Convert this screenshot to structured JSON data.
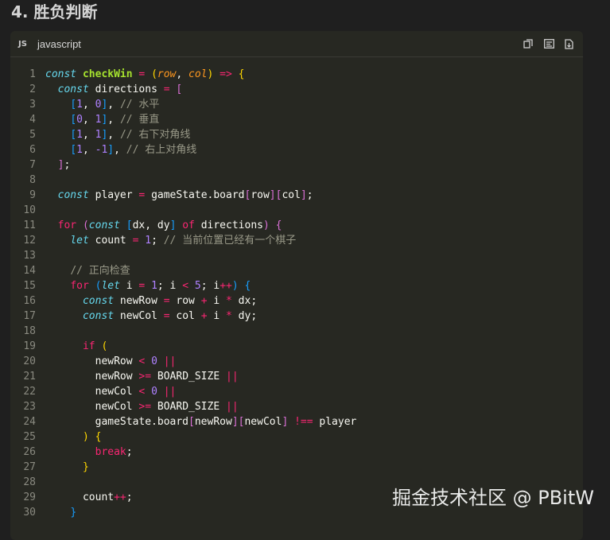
{
  "heading": "4. 胜负判断",
  "panel": {
    "badge": "JS",
    "language": "javascript",
    "actions": [
      "copy-icon",
      "wrap-icon",
      "download-icon"
    ]
  },
  "watermark": "掘金技术社区 @ PBitW",
  "colors": {
    "background": "#272822",
    "keyword": "#66d9ef",
    "control": "#f92672",
    "function": "#a6e22e",
    "param": "#fd971f",
    "number": "#ae81ff",
    "comment": "#999988"
  },
  "code": [
    {
      "n": "1",
      "t": [
        [
          "const",
          "kw"
        ],
        [
          " ",
          "id"
        ],
        [
          "checkWin",
          "fn"
        ],
        [
          " = ",
          "op"
        ],
        [
          "(",
          "br1"
        ],
        [
          "row",
          "param"
        ],
        [
          ", ",
          "punc"
        ],
        [
          "col",
          "param"
        ],
        [
          ")",
          "br1"
        ],
        [
          " => ",
          "op"
        ],
        [
          "{",
          "br1"
        ]
      ]
    },
    {
      "n": "2",
      "t": [
        [
          "  ",
          "id"
        ],
        [
          "const",
          "kw"
        ],
        [
          " directions",
          "id"
        ],
        [
          " = ",
          "op"
        ],
        [
          "[",
          "br2"
        ]
      ]
    },
    {
      "n": "3",
      "t": [
        [
          "    ",
          "id"
        ],
        [
          "[",
          "br3"
        ],
        [
          "1",
          "num"
        ],
        [
          ", ",
          "punc"
        ],
        [
          "0",
          "num"
        ],
        [
          "]",
          "br3"
        ],
        [
          ", ",
          "punc"
        ],
        [
          "// 水平",
          "cmt"
        ]
      ]
    },
    {
      "n": "4",
      "t": [
        [
          "    ",
          "id"
        ],
        [
          "[",
          "br3"
        ],
        [
          "0",
          "num"
        ],
        [
          ", ",
          "punc"
        ],
        [
          "1",
          "num"
        ],
        [
          "]",
          "br3"
        ],
        [
          ", ",
          "punc"
        ],
        [
          "// 垂直",
          "cmt"
        ]
      ]
    },
    {
      "n": "5",
      "t": [
        [
          "    ",
          "id"
        ],
        [
          "[",
          "br3"
        ],
        [
          "1",
          "num"
        ],
        [
          ", ",
          "punc"
        ],
        [
          "1",
          "num"
        ],
        [
          "]",
          "br3"
        ],
        [
          ", ",
          "punc"
        ],
        [
          "// 右下对角线",
          "cmt"
        ]
      ]
    },
    {
      "n": "6",
      "t": [
        [
          "    ",
          "id"
        ],
        [
          "[",
          "br3"
        ],
        [
          "1",
          "num"
        ],
        [
          ", ",
          "punc"
        ],
        [
          "-1",
          "num"
        ],
        [
          "]",
          "br3"
        ],
        [
          ", ",
          "punc"
        ],
        [
          "// 右上对角线",
          "cmt"
        ]
      ]
    },
    {
      "n": "7",
      "t": [
        [
          "  ",
          "id"
        ],
        [
          "]",
          "br2"
        ],
        [
          ";",
          "punc"
        ]
      ]
    },
    {
      "n": "8",
      "t": []
    },
    {
      "n": "9",
      "t": [
        [
          "  ",
          "id"
        ],
        [
          "const",
          "kw"
        ],
        [
          " player",
          "id"
        ],
        [
          " = ",
          "op"
        ],
        [
          "gameState.board",
          "id"
        ],
        [
          "[",
          "br2"
        ],
        [
          "row",
          "id"
        ],
        [
          "]",
          "br2"
        ],
        [
          "[",
          "br2"
        ],
        [
          "col",
          "id"
        ],
        [
          "]",
          "br2"
        ],
        [
          ";",
          "punc"
        ]
      ]
    },
    {
      "n": "10",
      "t": []
    },
    {
      "n": "11",
      "t": [
        [
          "  ",
          "id"
        ],
        [
          "for",
          "ctrl"
        ],
        [
          " ",
          "id"
        ],
        [
          "(",
          "br2"
        ],
        [
          "const",
          "kw"
        ],
        [
          " ",
          "id"
        ],
        [
          "[",
          "br3"
        ],
        [
          "dx, dy",
          "id"
        ],
        [
          "]",
          "br3"
        ],
        [
          " ",
          "id"
        ],
        [
          "of",
          "ctrl"
        ],
        [
          " directions",
          "id"
        ],
        [
          ")",
          "br2"
        ],
        [
          " ",
          "id"
        ],
        [
          "{",
          "br2"
        ]
      ]
    },
    {
      "n": "12",
      "t": [
        [
          "    ",
          "id"
        ],
        [
          "let",
          "kw"
        ],
        [
          " count",
          "id"
        ],
        [
          " = ",
          "op"
        ],
        [
          "1",
          "num"
        ],
        [
          "; ",
          "punc"
        ],
        [
          "// 当前位置已经有一个棋子",
          "cmt"
        ]
      ]
    },
    {
      "n": "13",
      "t": []
    },
    {
      "n": "14",
      "t": [
        [
          "    ",
          "id"
        ],
        [
          "// 正向检查",
          "cmt"
        ]
      ]
    },
    {
      "n": "15",
      "t": [
        [
          "    ",
          "id"
        ],
        [
          "for",
          "ctrl"
        ],
        [
          " ",
          "id"
        ],
        [
          "(",
          "br3"
        ],
        [
          "let",
          "kw"
        ],
        [
          " i",
          "id"
        ],
        [
          " = ",
          "op"
        ],
        [
          "1",
          "num"
        ],
        [
          "; i ",
          "punc"
        ],
        [
          "<",
          "op"
        ],
        [
          " ",
          "id"
        ],
        [
          "5",
          "num"
        ],
        [
          "; i",
          "punc"
        ],
        [
          "++",
          "op"
        ],
        [
          ")",
          "br3"
        ],
        [
          " ",
          "id"
        ],
        [
          "{",
          "br3"
        ]
      ]
    },
    {
      "n": "16",
      "t": [
        [
          "      ",
          "id"
        ],
        [
          "const",
          "kw"
        ],
        [
          " newRow",
          "id"
        ],
        [
          " = ",
          "op"
        ],
        [
          "row",
          "id"
        ],
        [
          " + ",
          "op"
        ],
        [
          "i",
          "id"
        ],
        [
          " * ",
          "op"
        ],
        [
          "dx;",
          "id"
        ]
      ]
    },
    {
      "n": "17",
      "t": [
        [
          "      ",
          "id"
        ],
        [
          "const",
          "kw"
        ],
        [
          " newCol",
          "id"
        ],
        [
          " = ",
          "op"
        ],
        [
          "col",
          "id"
        ],
        [
          " + ",
          "op"
        ],
        [
          "i",
          "id"
        ],
        [
          " * ",
          "op"
        ],
        [
          "dy;",
          "id"
        ]
      ]
    },
    {
      "n": "18",
      "t": []
    },
    {
      "n": "19",
      "t": [
        [
          "      ",
          "id"
        ],
        [
          "if",
          "ctrl"
        ],
        [
          " ",
          "id"
        ],
        [
          "(",
          "br1"
        ]
      ]
    },
    {
      "n": "20",
      "t": [
        [
          "        newRow",
          "id"
        ],
        [
          " < ",
          "op"
        ],
        [
          "0",
          "num"
        ],
        [
          " ||",
          "op"
        ]
      ]
    },
    {
      "n": "21",
      "t": [
        [
          "        newRow",
          "id"
        ],
        [
          " >= ",
          "op"
        ],
        [
          "BOARD_SIZE",
          "id"
        ],
        [
          " ||",
          "op"
        ]
      ]
    },
    {
      "n": "22",
      "t": [
        [
          "        newCol",
          "id"
        ],
        [
          " < ",
          "op"
        ],
        [
          "0",
          "num"
        ],
        [
          " ||",
          "op"
        ]
      ]
    },
    {
      "n": "23",
      "t": [
        [
          "        newCol",
          "id"
        ],
        [
          " >= ",
          "op"
        ],
        [
          "BOARD_SIZE",
          "id"
        ],
        [
          " ||",
          "op"
        ]
      ]
    },
    {
      "n": "24",
      "t": [
        [
          "        gameState.board",
          "id"
        ],
        [
          "[",
          "br2"
        ],
        [
          "newRow",
          "id"
        ],
        [
          "]",
          "br2"
        ],
        [
          "[",
          "br2"
        ],
        [
          "newCol",
          "id"
        ],
        [
          "]",
          "br2"
        ],
        [
          " !== ",
          "op"
        ],
        [
          "player",
          "id"
        ]
      ]
    },
    {
      "n": "25",
      "t": [
        [
          "      ",
          "id"
        ],
        [
          ")",
          "br1"
        ],
        [
          " ",
          "id"
        ],
        [
          "{",
          "br1"
        ]
      ]
    },
    {
      "n": "26",
      "t": [
        [
          "        ",
          "id"
        ],
        [
          "break",
          "ctrl"
        ],
        [
          ";",
          "punc"
        ]
      ]
    },
    {
      "n": "27",
      "t": [
        [
          "      ",
          "id"
        ],
        [
          "}",
          "br1"
        ]
      ]
    },
    {
      "n": "28",
      "t": []
    },
    {
      "n": "29",
      "t": [
        [
          "      count",
          "id"
        ],
        [
          "++",
          "op"
        ],
        [
          ";",
          "punc"
        ]
      ]
    },
    {
      "n": "30",
      "t": [
        [
          "    ",
          "id"
        ],
        [
          "}",
          "br3"
        ]
      ]
    }
  ]
}
